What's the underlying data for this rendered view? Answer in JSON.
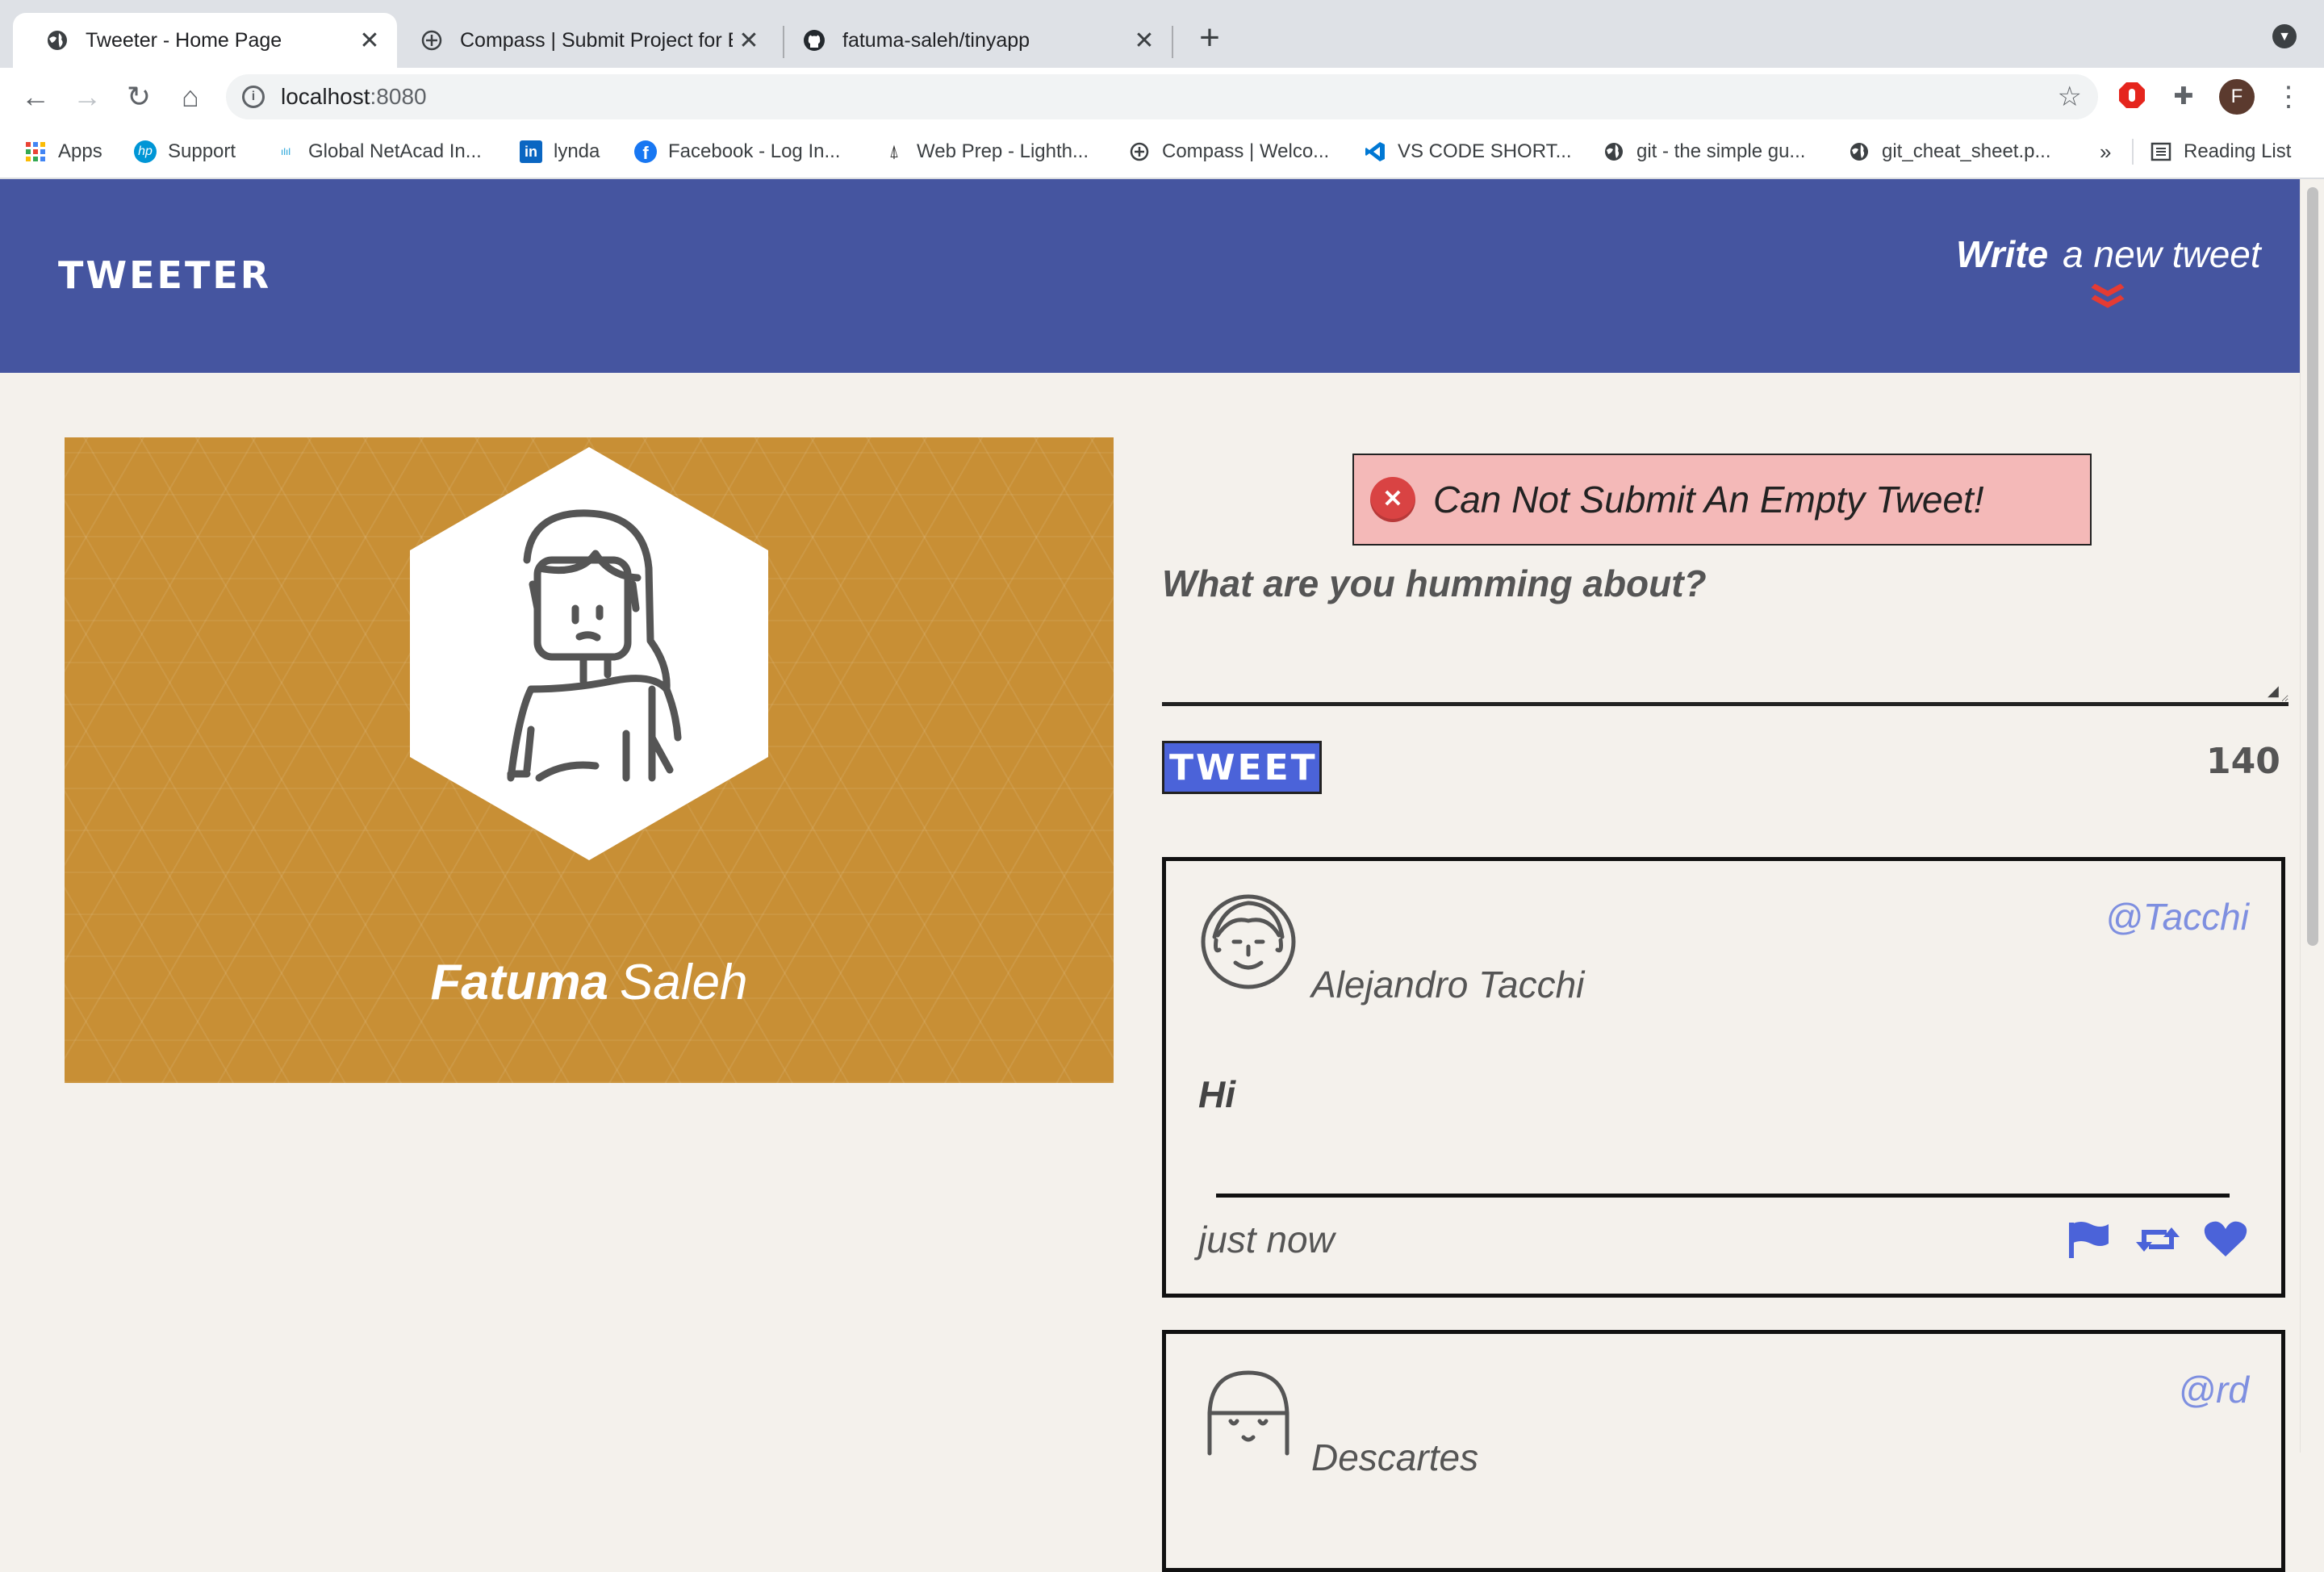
{
  "browser": {
    "tabs": [
      {
        "title": "Tweeter - Home Page",
        "icon": "globe-icon"
      },
      {
        "title": "Compass | Submit Project for E",
        "icon": "compass-icon"
      },
      {
        "title": "fatuma-saleh/tinyapp",
        "icon": "github-icon"
      }
    ],
    "url_host": "localhost",
    "url_port": ":8080",
    "profile_initial": "F",
    "bookmarks": [
      {
        "label": "Apps",
        "icon": "apps-grid-icon"
      },
      {
        "label": "Support",
        "icon": "hp-icon"
      },
      {
        "label": "Global NetAcad In...",
        "icon": "cisco-icon"
      },
      {
        "label": "lynda",
        "icon": "linkedin-icon"
      },
      {
        "label": "Facebook - Log In...",
        "icon": "facebook-icon"
      },
      {
        "label": "Web Prep - Lighth...",
        "icon": "lighthouse-icon"
      },
      {
        "label": "Compass | Welco...",
        "icon": "compass-icon"
      },
      {
        "label": "VS CODE SHORT...",
        "icon": "vscode-icon"
      },
      {
        "label": "git - the simple gu...",
        "icon": "globe-icon"
      },
      {
        "label": "git_cheat_sheet.p...",
        "icon": "globe-icon"
      }
    ],
    "overflow": "»",
    "reading_list": "Reading List"
  },
  "nav": {
    "brand": "TWEETER",
    "write_bold": "Write",
    "write_rest": "a new tweet",
    "chevron": "»"
  },
  "profile": {
    "first_name": "Fatuma",
    "last_name": "Saleh"
  },
  "compose": {
    "error": "Can Not Submit An Empty Tweet!",
    "label": "What are you humming about?",
    "value": "",
    "button": "TWEET",
    "counter": "140"
  },
  "tweets": [
    {
      "name": "Alejandro Tacchi",
      "handle": "@Tacchi",
      "content": "Hi",
      "time": "just now"
    },
    {
      "name": "Descartes",
      "handle": "@rd",
      "content": "",
      "time": ""
    }
  ],
  "colors": {
    "nav_bg": "#4555a0",
    "page_bg": "#f4f1ec",
    "profile_bg": "#c88f35",
    "accent_blue": "#4b63d9",
    "error_bg": "#f4b9b8",
    "chevron_red": "#e53b33"
  }
}
